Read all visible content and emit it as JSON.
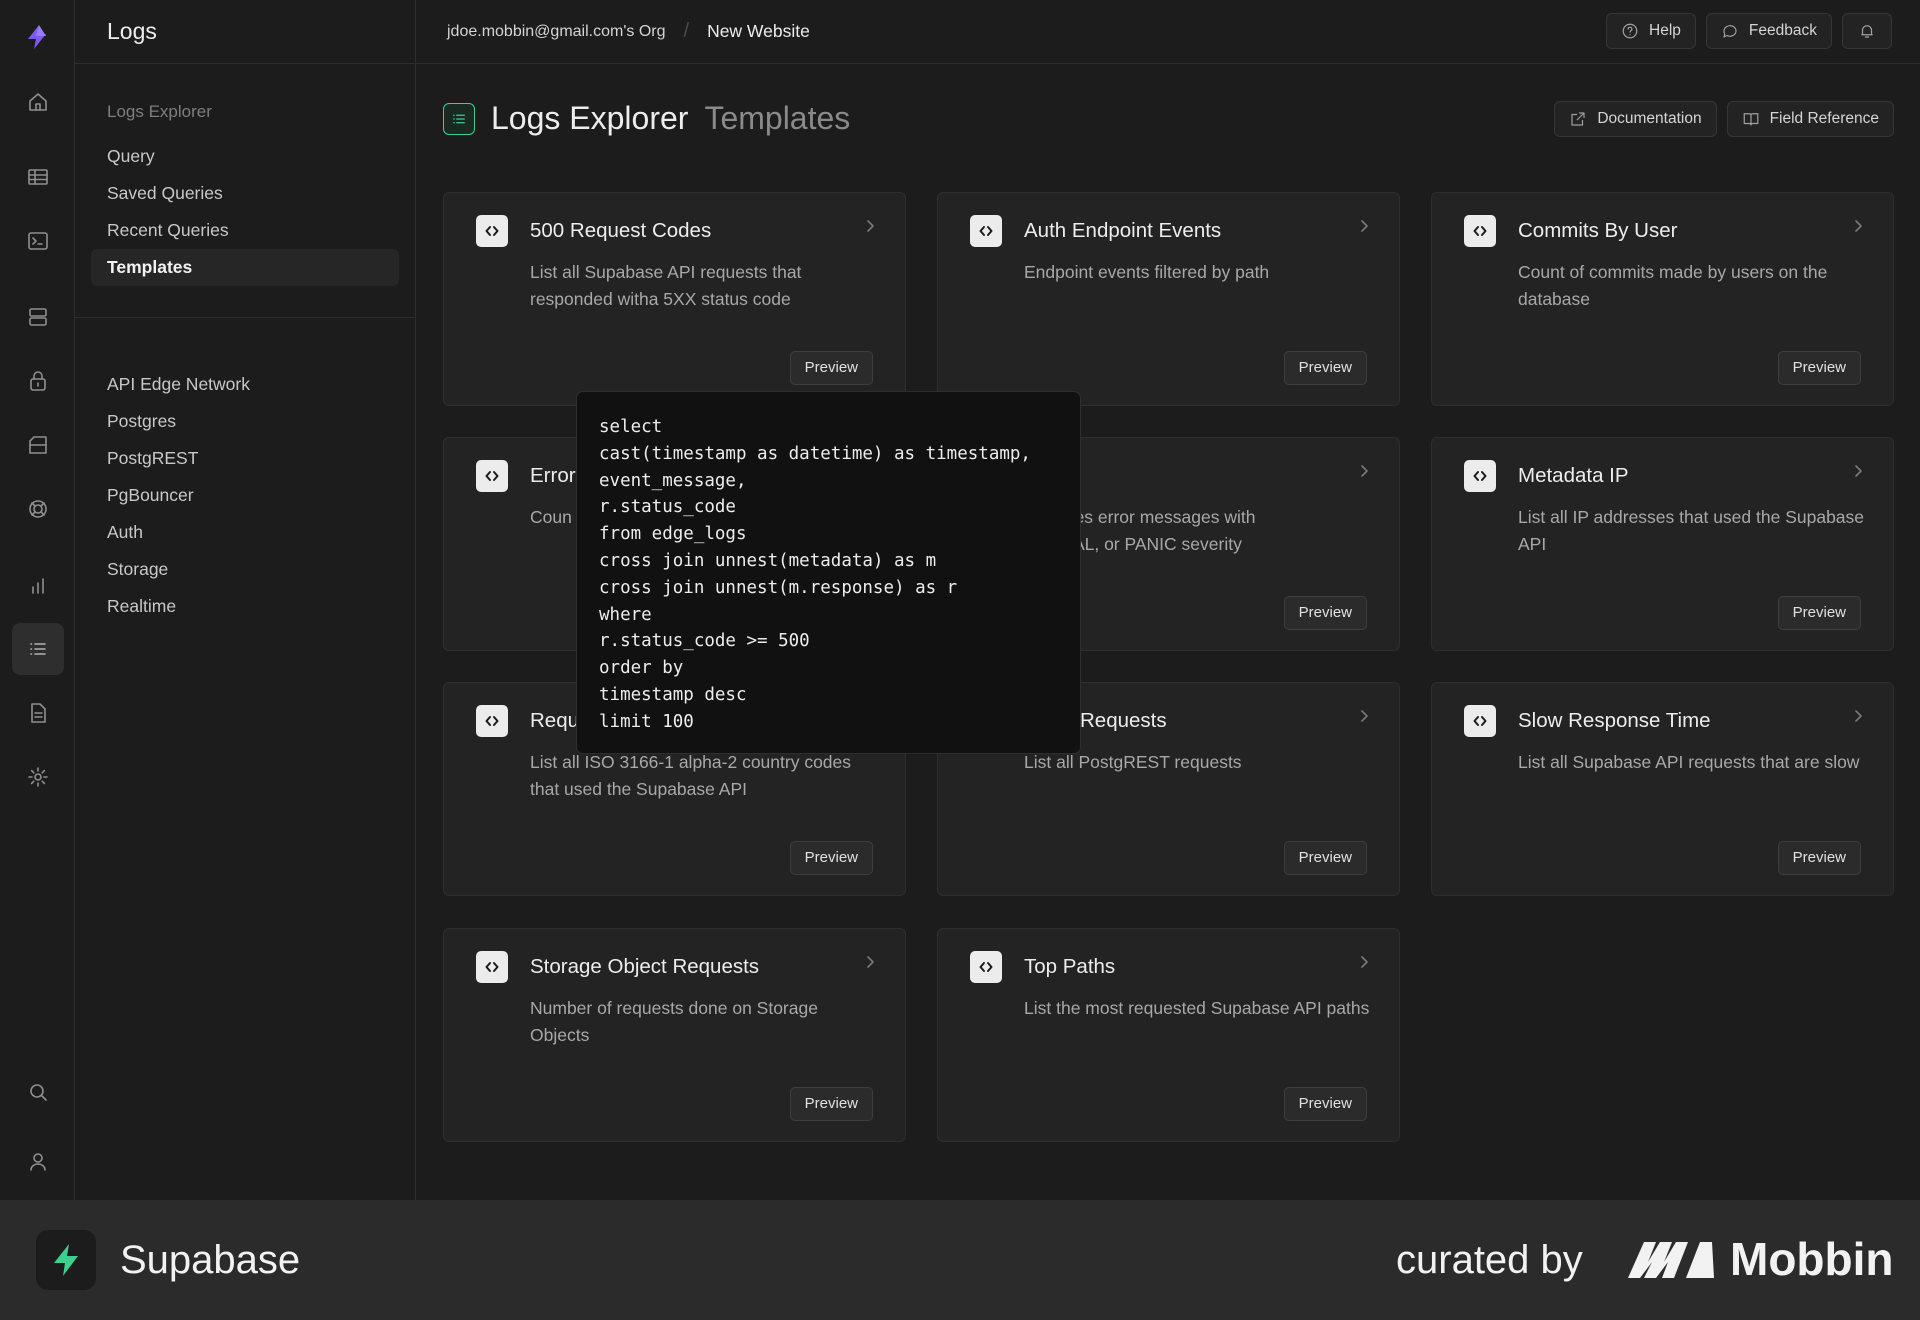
{
  "app": {
    "section_title": "Logs"
  },
  "breadcrumb": {
    "org": "jdoe.mobbin@gmail.com's Org",
    "separator": "/",
    "project": "New Website"
  },
  "topbar": {
    "help_label": "Help",
    "feedback_label": "Feedback"
  },
  "sidebar": {
    "group_title": "Logs Explorer",
    "items": [
      {
        "label": "Query",
        "active": false
      },
      {
        "label": "Saved Queries",
        "active": false
      },
      {
        "label": "Recent Queries",
        "active": false
      },
      {
        "label": "Templates",
        "active": true
      }
    ],
    "sources": [
      {
        "label": "API Edge Network"
      },
      {
        "label": "Postgres"
      },
      {
        "label": "PostgREST"
      },
      {
        "label": "PgBouncer"
      },
      {
        "label": "Auth"
      },
      {
        "label": "Storage"
      },
      {
        "label": "Realtime"
      }
    ]
  },
  "page": {
    "title": "Logs Explorer",
    "subtitle": "Templates",
    "documentation_label": "Documentation",
    "field_reference_label": "Field Reference"
  },
  "cards": [
    {
      "title": "500 Request Codes",
      "desc": "List all Supabase API requests that responded witha 5XX status code",
      "button": "Preview"
    },
    {
      "title": "Auth Endpoint Events",
      "desc": "Endpoint events filtered by path",
      "button": "Preview"
    },
    {
      "title": "Commits By User",
      "desc": "Count of commits made by users on the database",
      "button": "Preview"
    },
    {
      "title": "Error",
      "desc": "Coun",
      "button": ""
    },
    {
      "title": "",
      "desc": "Postgres error messages with\n2, FATAL, or PANIC severity",
      "button": "Preview"
    },
    {
      "title": "Metadata IP",
      "desc": "List all IP addresses that used the Supabase API",
      "button": "Preview"
    },
    {
      "title": "Requ",
      "desc": "List all ISO 3166-1 alpha-2 country codes that used the Supabase API",
      "button": "Preview"
    },
    {
      "title": "Requests",
      "desc": "List all PostgREST requests",
      "button": "Preview"
    },
    {
      "title": "Slow Response Time",
      "desc": "List all Supabase API requests that are slow",
      "button": "Preview"
    },
    {
      "title": "Storage Object Requests",
      "desc": "Number of requests done on Storage Objects",
      "button": "Preview"
    },
    {
      "title": "Top Paths",
      "desc": "List the most requested Supabase API paths",
      "button": "Preview"
    }
  ],
  "tooltip": {
    "code": "select\ncast(timestamp as datetime) as timestamp,\nevent_message,\nr.status_code\nfrom edge_logs\ncross join unnest(metadata) as m\ncross join unnest(m.response) as r\nwhere\nr.status_code >= 500\norder by\ntimestamp desc\nlimit 100"
  },
  "footer": {
    "brand": "Supabase",
    "curated_by": "curated by",
    "mobbin": "Mobbin"
  },
  "colors": {
    "accent": "#3ecf8e",
    "background": "#1c1c1c",
    "card": "#232323",
    "border": "#2e2e2e"
  },
  "icons": [
    "supabase-logo-icon",
    "home-icon",
    "table-icon",
    "terminal-icon",
    "database-icon",
    "lock-icon",
    "storage-icon",
    "realtime-icon",
    "reports-icon",
    "logs-icon",
    "docs-icon",
    "settings-icon",
    "search-icon",
    "user-icon",
    "help-icon",
    "feedback-icon",
    "bell-icon",
    "external-link-icon",
    "book-icon",
    "code-icon",
    "chevron-right-icon"
  ]
}
